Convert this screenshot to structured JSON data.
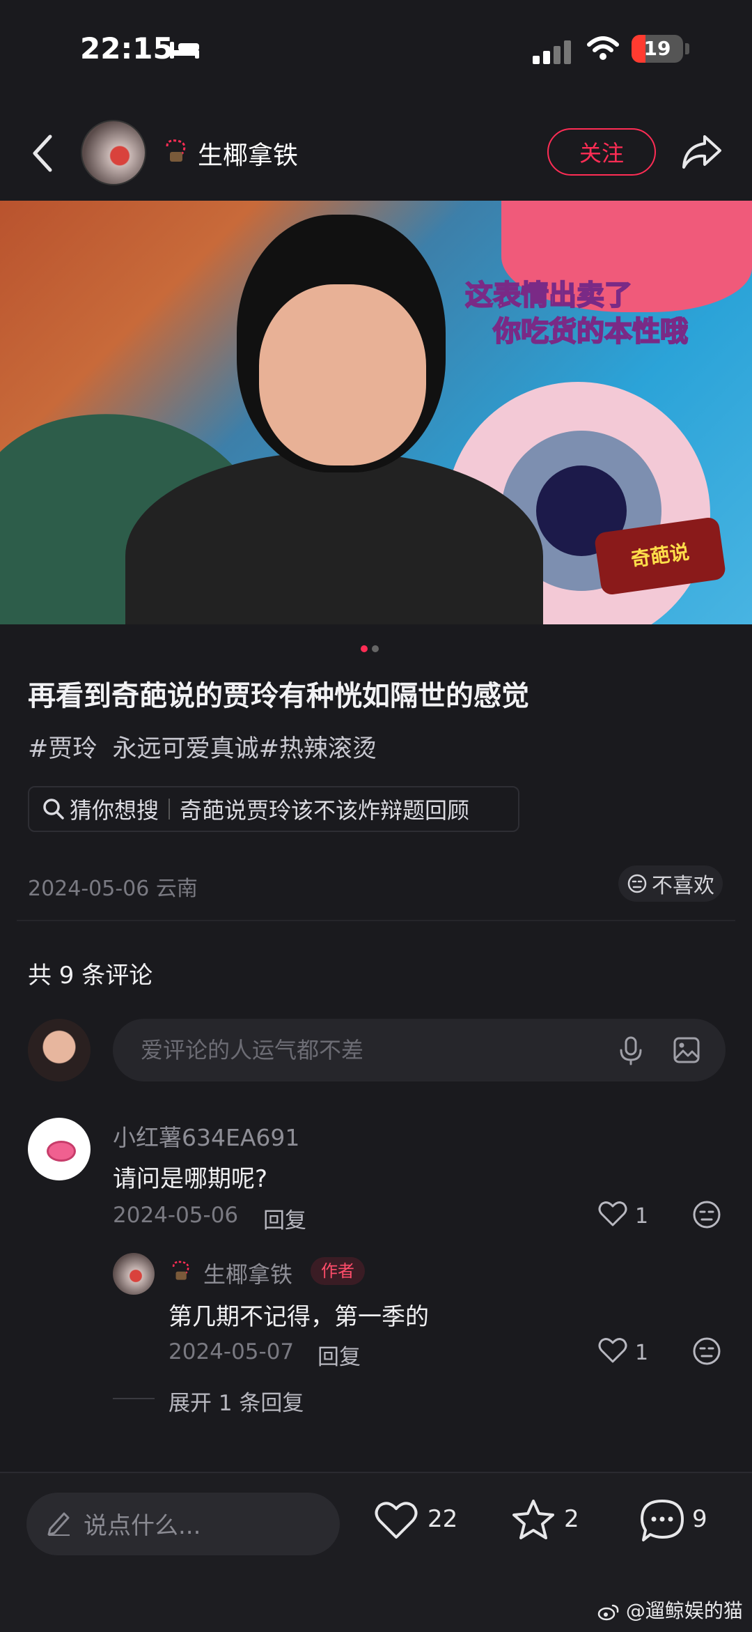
{
  "status": {
    "time": "22:15",
    "battery": "19"
  },
  "header": {
    "author": "生椰拿铁",
    "follow_label": "关注"
  },
  "hero": {
    "caption_line1": "这表情出卖了",
    "caption_line2": "你吃货的本性哦",
    "show_logo": "奇葩说"
  },
  "post": {
    "title": "再看到奇葩说的贾玲有种恍如隔世的感觉",
    "tags": "#贾玲  永远可爱真诚#热辣滚烫",
    "guess_label": "猜你想搜",
    "guess_query": "奇葩说贾玲该不该炸辩题回顾",
    "date_location": "2024-05-06 云南",
    "dislike_label": "不喜欢"
  },
  "comments_section": {
    "count_label": "共 9 条评论",
    "input_placeholder": "爱评论的人运气都不差"
  },
  "comments": [
    {
      "user": "小红薯634EA691",
      "text": "请问是哪期呢?",
      "date": "2024-05-06",
      "reply_label": "回复",
      "likes": "1",
      "replies": [
        {
          "user": "生椰拿铁",
          "tag": "作者",
          "text": "第几期不记得，第一季的",
          "date": "2024-05-07",
          "reply_label": "回复",
          "likes": "1"
        }
      ],
      "expand_label": "展开 1 条回复"
    }
  ],
  "bottom": {
    "say_placeholder": "说点什么...",
    "likes": "22",
    "stars": "2",
    "comments": "9"
  },
  "watermark": "@遛鲸娱的猫",
  "colors": {
    "accent": "#ff2d55",
    "background": "#1a1a1e"
  },
  "icons": [
    "back-icon",
    "share-icon",
    "search-icon",
    "mic-icon",
    "image-icon",
    "heart-icon",
    "meh-icon",
    "pen-icon",
    "star-icon",
    "chat-icon",
    "weibo-icon"
  ]
}
